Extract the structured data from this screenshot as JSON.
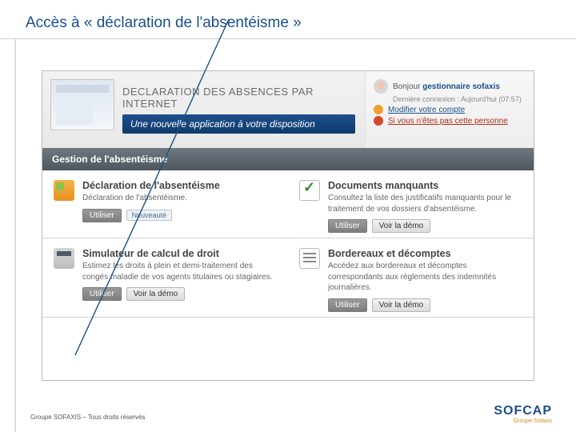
{
  "slide": {
    "title": "Accès à « déclaration de l'absentéisme »"
  },
  "hero": {
    "headline": "DECLARATION DES ABSENCES PAR INTERNET",
    "subhead": "Une nouvelle application à votre disposition"
  },
  "userbox": {
    "greeting_prefix": "Bonjour",
    "greeting_name": "gestionnaire sofaxis",
    "last_login": "Dernière connexion : Aujourd'hui (07:57)",
    "edit_account": "Modifier votre compte",
    "not_you": "Si vous n'êtes pas cette personne"
  },
  "section": {
    "title": "Gestion de l'absentéisme"
  },
  "modules": [
    {
      "title": "Déclaration de l'absentéisme",
      "desc": "Déclaration de l'absentéisme.",
      "buttons": {
        "use": "Utiliser",
        "new": "Nouveauté"
      }
    },
    {
      "title": "Documents manquants",
      "desc": "Consultez la liste des justificatifs manquants pour le traitement de vos dossiers d'absentéisme.",
      "buttons": {
        "use": "Utiliser",
        "demo": "Voir la démo"
      }
    },
    {
      "title": "Simulateur de calcul de droit",
      "desc": "Estimez les droits à plein et demi-traitement des congés maladie de vos agents titulaires ou stagiaires.",
      "buttons": {
        "use": "Utiliser",
        "demo": "Voir la démo"
      }
    },
    {
      "title": "Bordereaux et décomptes",
      "desc": "Accédez aux bordereaux et décomptes correspondants aux règlements des indemnités journalières.",
      "buttons": {
        "use": "Utiliser",
        "demo": "Voir la démo"
      }
    }
  ],
  "footer": {
    "copyright": "Groupe SOFAXIS – Tous droits réservés",
    "brand": "SOFCAP",
    "tagline": "Groupe Sofaxis"
  }
}
